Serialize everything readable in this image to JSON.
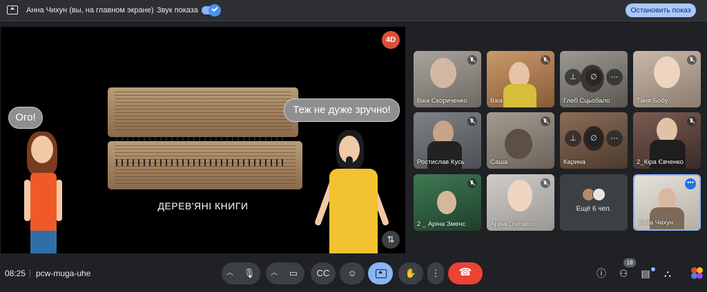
{
  "topbar": {
    "presenting_label": "Анна Чихун (вы, на главном экране)",
    "sound_label": "Звук показа",
    "sound_enabled": true,
    "stop_button": "Остановить показ"
  },
  "presentation": {
    "logo_text": "4D",
    "bubble_left": "Ого!",
    "bubble_right": "Теж не дуже зручно!",
    "slide_title": "ДЕРЕВ'ЯНІ КНИГИ"
  },
  "tiles": [
    {
      "name": "Віка Скориченко",
      "muted": true,
      "bg": "#8f8a84"
    },
    {
      "name": "Віка",
      "muted": true,
      "bg": "#b9865a"
    },
    {
      "name": "Глеб Сцьобало",
      "muted": false,
      "bg": "#7a7670",
      "pinned_overlay": true
    },
    {
      "name": "Таня Бобу",
      "muted": true,
      "bg": "#b8a79a"
    },
    {
      "name": "Ростислав Кусь",
      "muted": true,
      "bg": "#6b6e72"
    },
    {
      "name": "Саша",
      "muted": true,
      "bg": "#8e867c"
    },
    {
      "name": "Карина",
      "muted": true,
      "bg": "#6e5a4a",
      "pinned_overlay": true
    },
    {
      "name": "2_Кіра Євченко",
      "muted": true,
      "bg": "#4e3f3a"
    },
    {
      "name": "2 _ Аріна Зменс",
      "muted": true,
      "bg": "#2d5b3c"
    },
    {
      "name": "Аріна Osmano",
      "muted": true,
      "bg": "#b8b6b4"
    },
    {
      "name": "Анна Чихун",
      "muted": false,
      "bg": "#d9d3cc",
      "self": true
    }
  ],
  "others_tile": {
    "label": "Ещё 6 чел."
  },
  "bottombar": {
    "time": "08:25",
    "meeting_code": "pcw-muga-uhe",
    "people_count": "18"
  },
  "colors": {
    "accent": "#8ab4f8",
    "end_call": "#ea4335",
    "background": "#202124"
  },
  "icons": [
    "present-screen-icon",
    "mic-icon",
    "camera-icon",
    "captions-icon",
    "emoji-icon",
    "present-now-icon",
    "raise-hand-icon",
    "more-options-icon",
    "end-call-icon",
    "info-icon",
    "people-icon",
    "chat-icon",
    "activities-icon",
    "mic-off-icon",
    "pin-icon"
  ]
}
